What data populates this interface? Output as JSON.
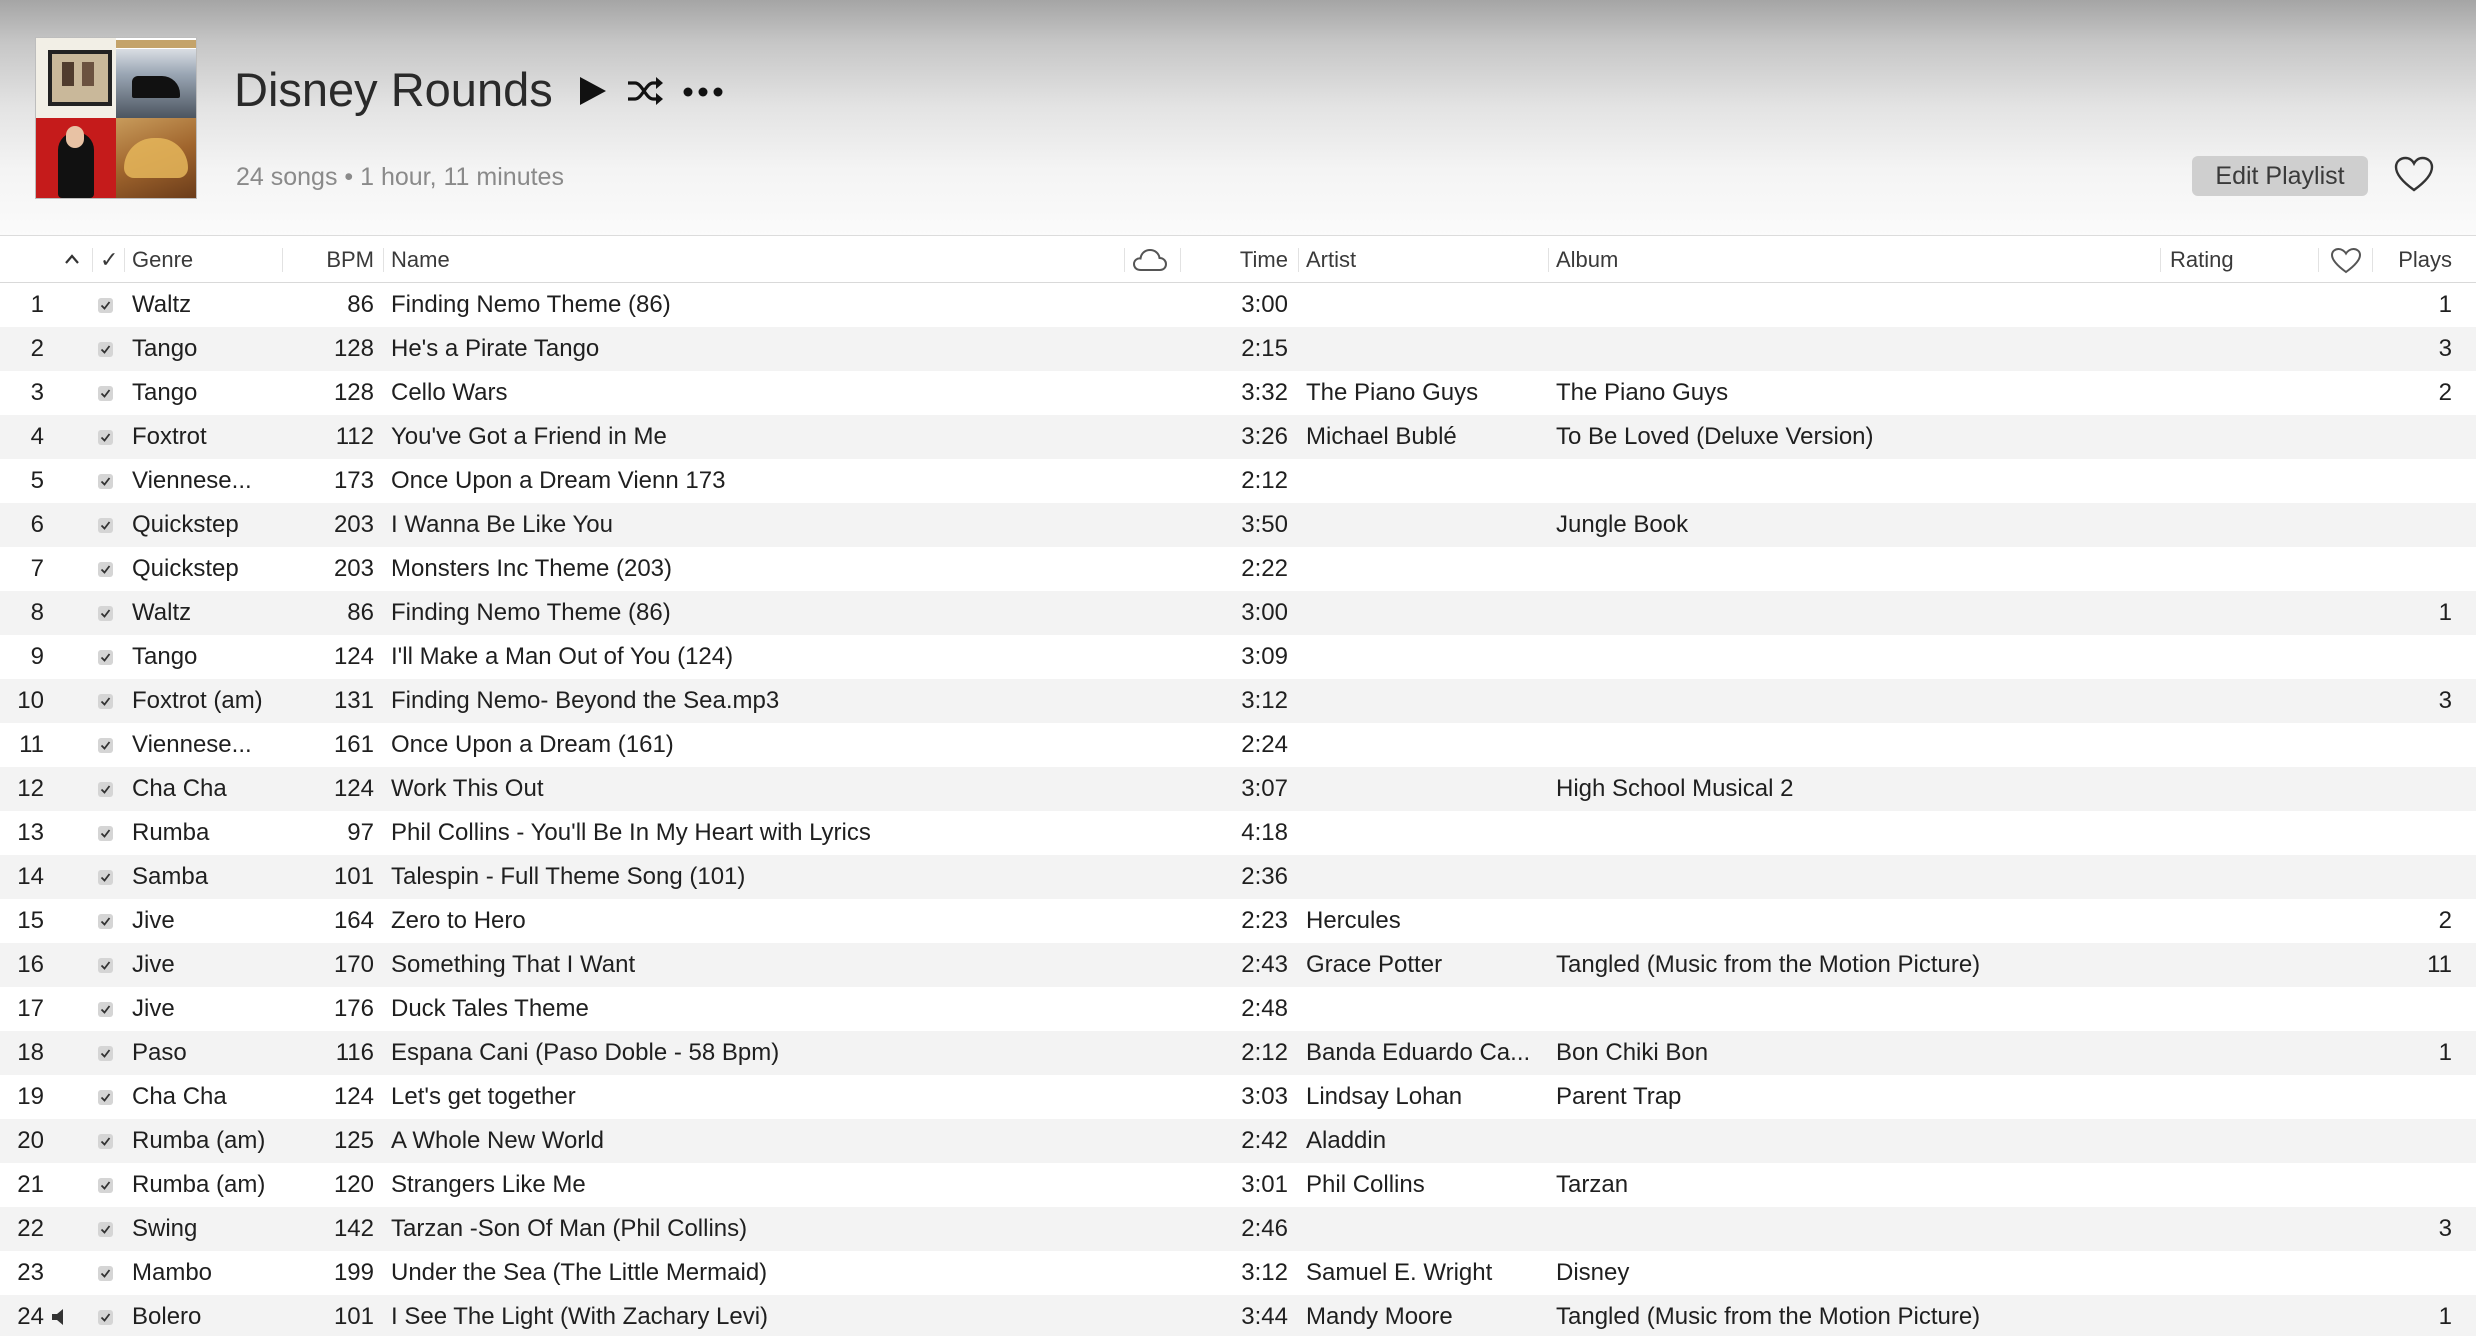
{
  "header": {
    "title": "Disney Rounds",
    "subtitle": "24 songs • 1 hour, 11 minutes",
    "edit_label": "Edit Playlist",
    "icons": [
      "play-icon",
      "shuffle-icon",
      "more-icon",
      "heart-icon"
    ]
  },
  "columns": {
    "sort": "^",
    "check": "✓",
    "genre": "Genre",
    "bpm": "BPM",
    "name": "Name",
    "cloud": "cloud-icon",
    "time": "Time",
    "artist": "Artist",
    "album": "Album",
    "rating": "Rating",
    "love": "heart-icon",
    "plays": "Plays"
  },
  "tracks": [
    {
      "num": "1",
      "genre": "Waltz",
      "bpm": "86",
      "name": "Finding Nemo Theme (86)",
      "time": "3:00",
      "artist": "",
      "album": "",
      "plays": "1"
    },
    {
      "num": "2",
      "genre": "Tango",
      "bpm": "128",
      "name": "He's a Pirate Tango",
      "time": "2:15",
      "artist": "",
      "album": "",
      "plays": "3"
    },
    {
      "num": "3",
      "genre": "Tango",
      "bpm": "128",
      "name": "Cello Wars",
      "time": "3:32",
      "artist": "The Piano Guys",
      "album": "The Piano Guys",
      "plays": "2"
    },
    {
      "num": "4",
      "genre": "Foxtrot",
      "bpm": "112",
      "name": "You've Got a Friend in Me",
      "time": "3:26",
      "artist": "Michael Bublé",
      "album": "To Be Loved (Deluxe Version)",
      "plays": ""
    },
    {
      "num": "5",
      "genre": "Viennese...",
      "bpm": "173",
      "name": "Once Upon a Dream Vienn 173",
      "time": "2:12",
      "artist": "",
      "album": "",
      "plays": ""
    },
    {
      "num": "6",
      "genre": "Quickstep",
      "bpm": "203",
      "name": "I Wanna Be Like You",
      "time": "3:50",
      "artist": "",
      "album": "Jungle Book",
      "plays": ""
    },
    {
      "num": "7",
      "genre": "Quickstep",
      "bpm": "203",
      "name": "Monsters Inc Theme (203)",
      "time": "2:22",
      "artist": "",
      "album": "",
      "plays": ""
    },
    {
      "num": "8",
      "genre": "Waltz",
      "bpm": "86",
      "name": "Finding Nemo Theme (86)",
      "time": "3:00",
      "artist": "",
      "album": "",
      "plays": "1"
    },
    {
      "num": "9",
      "genre": "Tango",
      "bpm": "124",
      "name": "I'll Make a Man Out of You (124)",
      "time": "3:09",
      "artist": "",
      "album": "",
      "plays": ""
    },
    {
      "num": "10",
      "genre": "Foxtrot (am)",
      "bpm": "131",
      "name": "Finding Nemo- Beyond the Sea.mp3",
      "time": "3:12",
      "artist": "",
      "album": "",
      "plays": "3"
    },
    {
      "num": "11",
      "genre": "Viennese...",
      "bpm": "161",
      "name": "Once Upon a Dream (161)",
      "time": "2:24",
      "artist": "",
      "album": "",
      "plays": ""
    },
    {
      "num": "12",
      "genre": "Cha Cha",
      "bpm": "124",
      "name": "Work This Out",
      "time": "3:07",
      "artist": "",
      "album": "High School Musical 2",
      "plays": ""
    },
    {
      "num": "13",
      "genre": "Rumba",
      "bpm": "97",
      "name": "Phil Collins - You'll Be In My Heart with Lyrics",
      "time": "4:18",
      "artist": "",
      "album": "",
      "plays": ""
    },
    {
      "num": "14",
      "genre": "Samba",
      "bpm": "101",
      "name": "Talespin - Full Theme Song (101)",
      "time": "2:36",
      "artist": "",
      "album": "",
      "plays": ""
    },
    {
      "num": "15",
      "genre": "Jive",
      "bpm": "164",
      "name": "Zero to Hero",
      "time": "2:23",
      "artist": "Hercules",
      "album": "",
      "plays": "2"
    },
    {
      "num": "16",
      "genre": "Jive",
      "bpm": "170",
      "name": "Something That I Want",
      "time": "2:43",
      "artist": "Grace Potter",
      "album": "Tangled (Music from the Motion Picture)",
      "plays": "11"
    },
    {
      "num": "17",
      "genre": "Jive",
      "bpm": "176",
      "name": "Duck Tales Theme",
      "time": "2:48",
      "artist": "",
      "album": "",
      "plays": ""
    },
    {
      "num": "18",
      "genre": "Paso",
      "bpm": "116",
      "name": "Espana Cani (Paso Doble - 58 Bpm)",
      "time": "2:12",
      "artist": "Banda Eduardo Ca...",
      "album": "Bon Chiki Bon",
      "plays": "1"
    },
    {
      "num": "19",
      "genre": "Cha Cha",
      "bpm": "124",
      "name": "Let's get together",
      "time": "3:03",
      "artist": "Lindsay Lohan",
      "album": "Parent Trap",
      "plays": ""
    },
    {
      "num": "20",
      "genre": "Rumba (am)",
      "bpm": "125",
      "name": "A Whole New World",
      "time": "2:42",
      "artist": "Aladdin",
      "album": "",
      "plays": ""
    },
    {
      "num": "21",
      "genre": "Rumba (am)",
      "bpm": "120",
      "name": "Strangers Like Me",
      "time": "3:01",
      "artist": "Phil Collins",
      "album": "Tarzan",
      "plays": ""
    },
    {
      "num": "22",
      "genre": "Swing",
      "bpm": "142",
      "name": "Tarzan -Son Of Man (Phil Collins)",
      "time": "2:46",
      "artist": "",
      "album": "",
      "plays": "3"
    },
    {
      "num": "23",
      "genre": "Mambo",
      "bpm": "199",
      "name": "Under the Sea (The Little Mermaid)",
      "time": "3:12",
      "artist": "Samuel E. Wright",
      "album": "Disney",
      "plays": ""
    },
    {
      "num": "24",
      "genre": "Bolero",
      "bpm": "101",
      "name": "I See The Light (With Zachary Levi)",
      "time": "3:44",
      "artist": "Mandy Moore",
      "album": "Tangled (Music from the Motion Picture)",
      "plays": "1",
      "now_playing": true
    }
  ]
}
